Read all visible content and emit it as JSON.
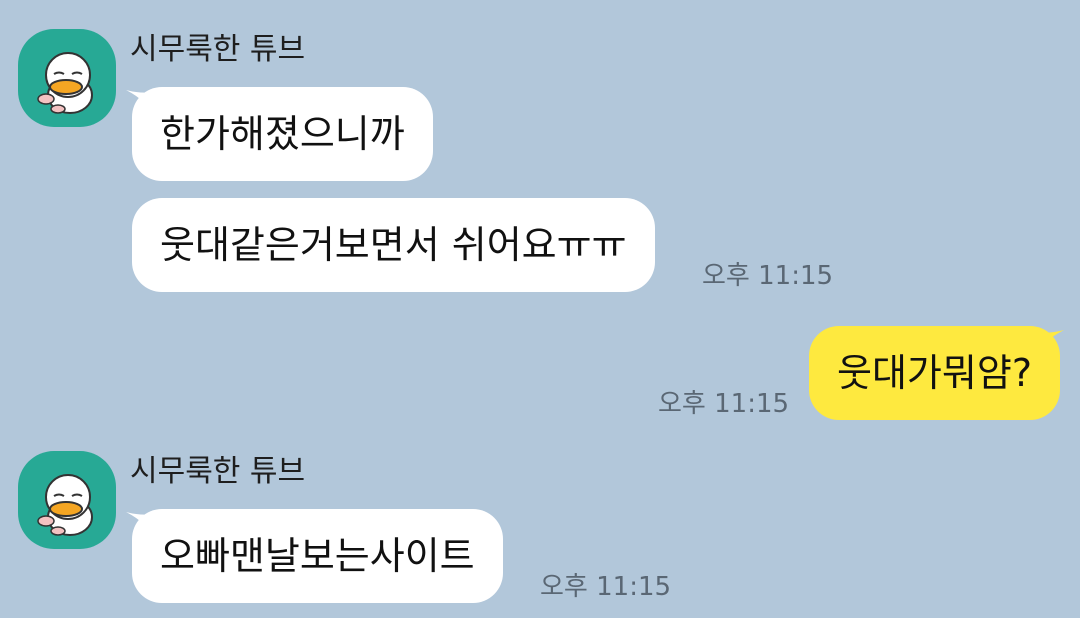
{
  "colors": {
    "background": "#b2c7da",
    "incoming_bubble": "#ffffff",
    "outgoing_bubble": "#fee93f",
    "avatar_bg": "#27a995",
    "timestamp": "#5a6774"
  },
  "chat": {
    "groups": [
      {
        "sender": "시무룩한 튜브",
        "avatar_icon": "tube-duck-avatar-icon",
        "messages": [
          {
            "text": "한가해졌으니까"
          },
          {
            "text": "웃대같은거보면서 쉬어요ㅠㅠ",
            "time": "오후 11:15"
          }
        ]
      },
      {
        "sender": "me",
        "messages": [
          {
            "text": "웃대가뭐얌?",
            "time": "오후 11:15"
          }
        ]
      },
      {
        "sender": "시무룩한 튜브",
        "avatar_icon": "tube-duck-avatar-icon",
        "messages": [
          {
            "text": "오빠맨날보는사이트",
            "time": "오후 11:15"
          }
        ]
      }
    ]
  }
}
